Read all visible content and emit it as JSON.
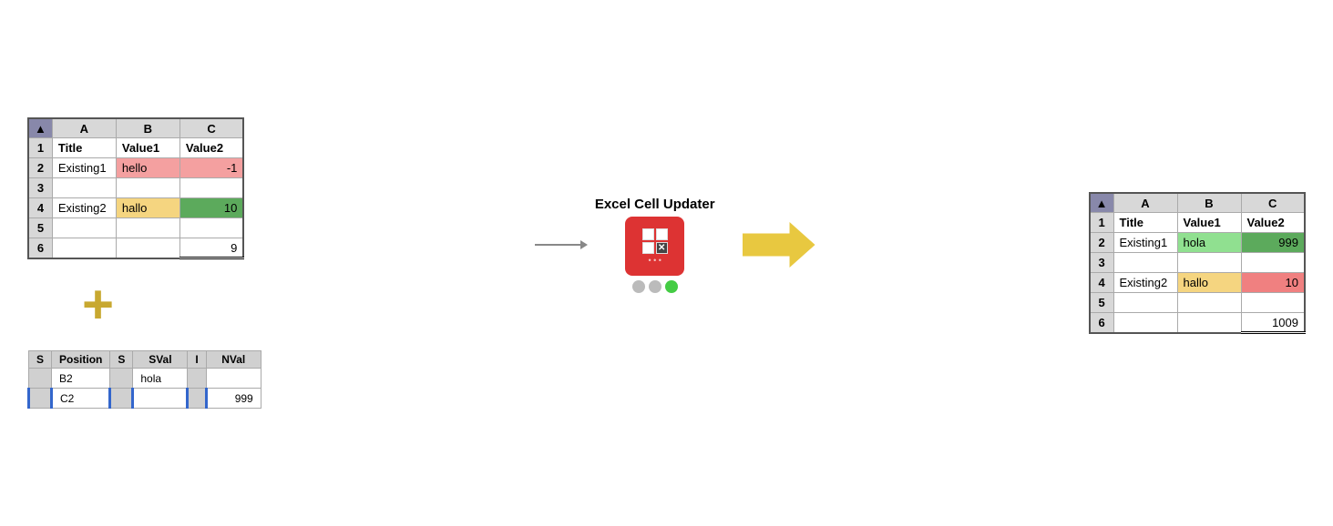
{
  "left_spreadsheet": {
    "headers": [
      "",
      "A",
      "B",
      "C"
    ],
    "rows": [
      {
        "row": "1",
        "a": "Title",
        "b": "Value1",
        "c": "Value2",
        "a_style": "bold",
        "b_style": "bold",
        "c_style": "bold"
      },
      {
        "row": "2",
        "a": "Existing1",
        "b": "hello",
        "c": "-1",
        "b_style": "pink",
        "c_style": "red"
      },
      {
        "row": "3",
        "a": "",
        "b": "",
        "c": ""
      },
      {
        "row": "4",
        "a": "Existing2",
        "b": "hallo",
        "c": "10",
        "b_style": "yellow",
        "c_style": "green"
      },
      {
        "row": "5",
        "a": "",
        "b": "",
        "c": ""
      },
      {
        "row": "6",
        "a": "",
        "b": "",
        "c": "9",
        "c_style": "right double-bottom"
      }
    ]
  },
  "plus_symbol": "+",
  "input_table": {
    "headers": [
      {
        "type": "S",
        "label": "Position"
      },
      {
        "type": "S",
        "label": "SVal"
      },
      {
        "type": "I",
        "label": "NVal"
      }
    ],
    "rows": [
      {
        "position": "B2",
        "sval": "hola",
        "nval": ""
      },
      {
        "position": "C2",
        "sval": "",
        "nval": "999"
      }
    ]
  },
  "component": {
    "label": "Excel Cell Updater",
    "dots": [
      "gray",
      "gray",
      "green"
    ]
  },
  "right_spreadsheet": {
    "headers": [
      "",
      "A",
      "B",
      "C"
    ],
    "rows": [
      {
        "row": "1",
        "a": "Title",
        "b": "Value1",
        "c": "Value2",
        "a_style": "bold",
        "b_style": "bold",
        "c_style": "bold"
      },
      {
        "row": "2",
        "a": "Existing1",
        "b": "hola",
        "c": "999",
        "b_style": "lightgreen",
        "c_style": "green"
      },
      {
        "row": "3",
        "a": "",
        "b": "",
        "c": ""
      },
      {
        "row": "4",
        "a": "Existing2",
        "b": "hallo",
        "c": "10",
        "b_style": "yellow",
        "c_style": "red"
      },
      {
        "row": "5",
        "a": "",
        "b": "",
        "c": ""
      },
      {
        "row": "6",
        "a": "",
        "b": "",
        "c": "1009",
        "c_style": "right double-bottom"
      }
    ]
  }
}
